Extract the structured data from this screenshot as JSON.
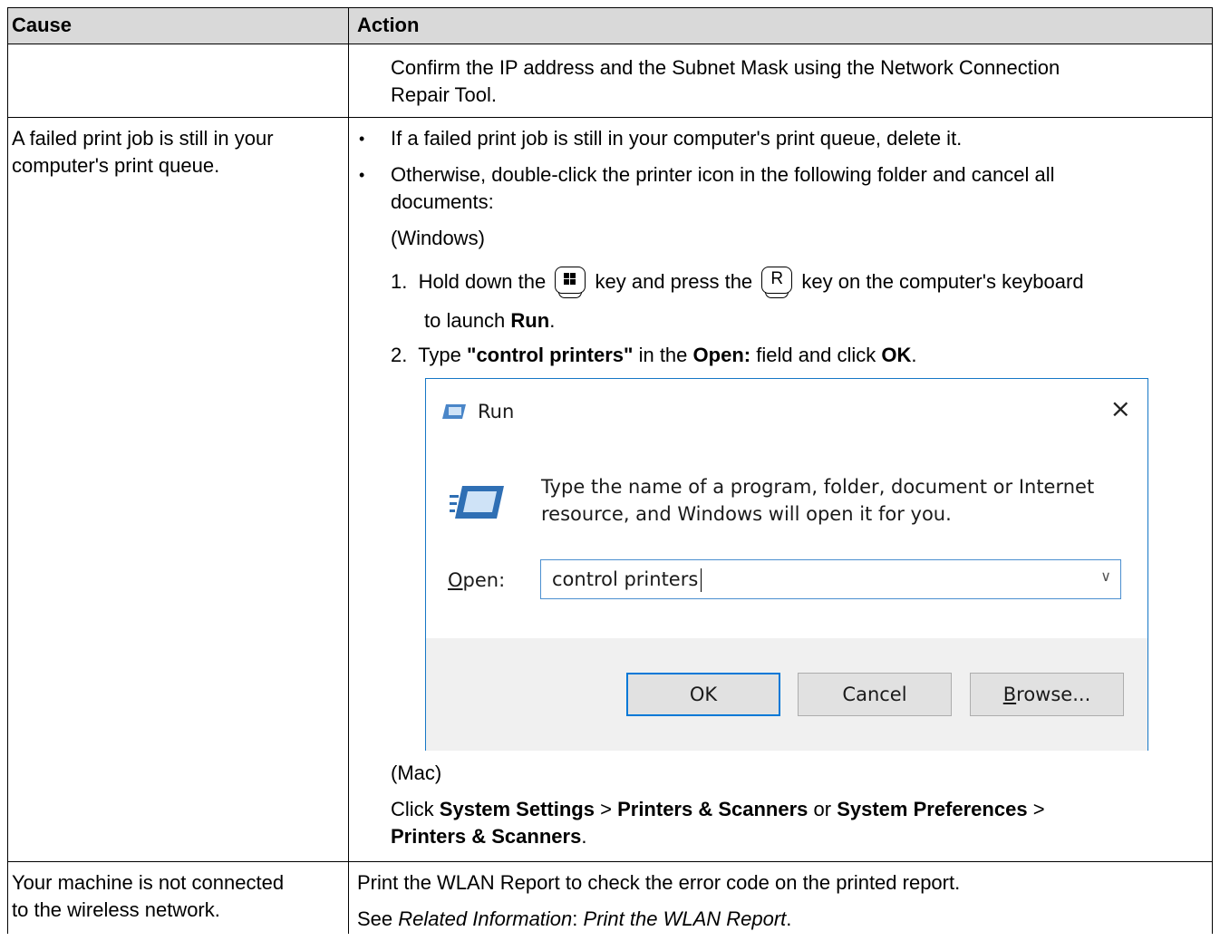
{
  "header": {
    "cause": "Cause",
    "action": "Action"
  },
  "row1": {
    "action_line1": "Confirm the IP address and the Subnet Mask using the Network Connection",
    "action_line2": "Repair Tool."
  },
  "row2": {
    "cause_line1": "A failed print job is still in your",
    "cause_line2": "computer's print queue.",
    "bullet": "•",
    "bullet1": "If a failed print job is still in your computer's print queue, delete it.",
    "bullet2_line1": "Otherwise, double-click the printer icon in the following folder and cancel all",
    "bullet2_line2": "documents:",
    "windows_label": "(Windows)",
    "step1": {
      "num": "1.",
      "pre": "Hold down the",
      "mid": "key and press the",
      "key_r": "R",
      "post": "key on the computer's keyboard",
      "line2_pre": "to launch",
      "run": "Run",
      "dot": "."
    },
    "step2": {
      "num": "2.",
      "pre": "Type",
      "cmd": "\"control printers\"",
      "mid": "in the",
      "open": "Open:",
      "mid2": "field and click",
      "ok": "OK",
      "dot": "."
    },
    "dialog": {
      "title": "Run",
      "close": "×",
      "desc_line1": "Type the name of a program, folder, document or Internet",
      "desc_line2": "resource, and Windows will open it for you.",
      "open_label": "Open:",
      "open_value": "control printers",
      "ok": "OK",
      "cancel": "Cancel",
      "browse": "Browse...",
      "accent": "#0078d7"
    },
    "mac_label": "(Mac)",
    "mac": {
      "click": "Click",
      "sys_settings": "System Settings",
      "gt": ">",
      "printers_scanners": "Printers & Scanners",
      "or": "or",
      "sys_prefs": "System Preferences",
      "dot": "."
    }
  },
  "row3": {
    "cause_line1": "Your machine is not connected",
    "cause_line2": "to the wireless network.",
    "action_line1": "Print the WLAN Report to check the error code on the printed report.",
    "see": "See",
    "related": "Related Information",
    "colon": ":",
    "link": "Print the WLAN Report",
    "dot": "."
  }
}
